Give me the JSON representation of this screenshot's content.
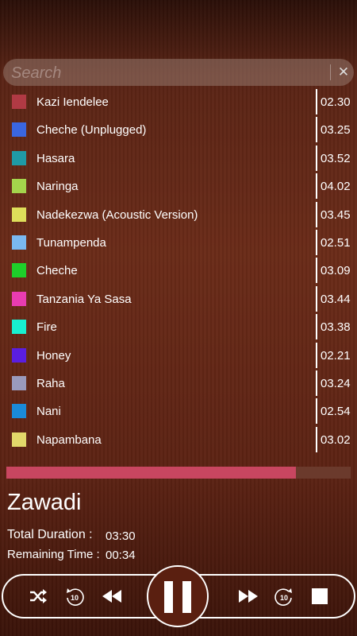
{
  "search": {
    "placeholder": "Search",
    "clear_icon": "close-icon"
  },
  "tracks": [
    {
      "title": "Kazi Iendelee",
      "duration": "02.30",
      "color": "#b03a44"
    },
    {
      "title": "Cheche (Unplugged)",
      "duration": "03.25",
      "color": "#3a66e0"
    },
    {
      "title": "Hasara",
      "duration": "03.52",
      "color": "#1f9aa6"
    },
    {
      "title": "Naringa",
      "duration": "04.02",
      "color": "#a4d44c"
    },
    {
      "title": "Nadekezwa (Acoustic Version)",
      "duration": "03.45",
      "color": "#dede5a"
    },
    {
      "title": "Tunampenda",
      "duration": "02.51",
      "color": "#7ab8f0"
    },
    {
      "title": "Cheche",
      "duration": "03.09",
      "color": "#1ecf2a"
    },
    {
      "title": "Tanzania Ya Sasa",
      "duration": "03.44",
      "color": "#e83cb0"
    },
    {
      "title": "Fire",
      "duration": "03.38",
      "color": "#18f0d0"
    },
    {
      "title": "Honey",
      "duration": "02.21",
      "color": "#5a1ee0"
    },
    {
      "title": "Raha",
      "duration": "03.24",
      "color": "#9a9abc"
    },
    {
      "title": "Nani",
      "duration": "02.54",
      "color": "#1a8ad8"
    },
    {
      "title": "Napambana",
      "duration": "03.02",
      "color": "#e2d86a"
    }
  ],
  "player": {
    "progress": 0.84,
    "now_playing": "Zawadi",
    "total_label": "Total Duration :",
    "total_value": "03:30",
    "remaining_label": "Remaining Time :",
    "remaining_value": "00:34",
    "replay_seconds": "10",
    "forward_seconds": "10",
    "accent": "#c84660"
  }
}
